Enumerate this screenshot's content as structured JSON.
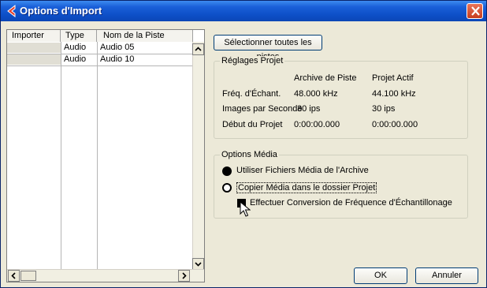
{
  "window": {
    "title": "Options d'Import"
  },
  "tracklist": {
    "columns": [
      "Importer",
      "Type",
      "Nom de la Piste"
    ],
    "rows": [
      {
        "type": "Audio",
        "name": "Audio 05"
      },
      {
        "type": "Audio",
        "name": "Audio 10"
      }
    ]
  },
  "select_all_label": "Sélectionner toutes les pistes",
  "project_settings": {
    "title": "Réglages Projet",
    "col_archive": "Archive de Piste",
    "col_project": "Projet Actif",
    "rows": [
      {
        "label": "Fréq. d'Échant.",
        "archive": "48.000 kHz",
        "project": "44.100 kHz"
      },
      {
        "label": "Images par Seconde",
        "archive": "30 ips",
        "project": "30 ips"
      },
      {
        "label": "Début du Projet",
        "archive": "0:00:00.000",
        "project": "0:00:00.000"
      }
    ]
  },
  "media_options": {
    "title": "Options Média",
    "radio_archive": "Utiliser Fichiers Média de l'Archive",
    "radio_copy": "Copier Média dans le dossier Projet",
    "checkbox_convert": "Effectuer Conversion de Fréquence d'Échantillonage"
  },
  "buttons": {
    "ok": "OK",
    "cancel": "Annuler"
  }
}
